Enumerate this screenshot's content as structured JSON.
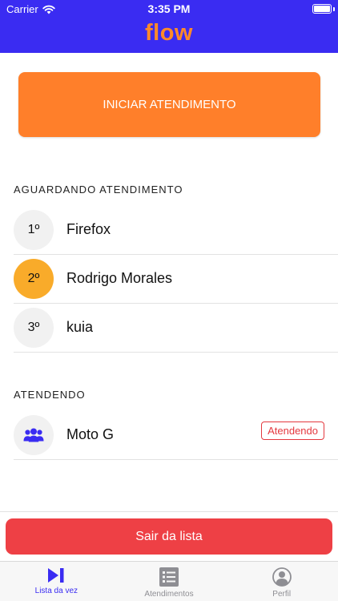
{
  "status_bar": {
    "carrier": "Carrier",
    "time": "3:35 PM"
  },
  "header": {
    "logo": "flow"
  },
  "start_button": {
    "label": "INICIAR ATENDIMENTO"
  },
  "waiting": {
    "title": "AGUARDANDO ATENDIMENTO",
    "items": [
      {
        "position": "1º",
        "name": "Firefox",
        "highlighted": false
      },
      {
        "position": "2º",
        "name": "Rodrigo Morales",
        "highlighted": true
      },
      {
        "position": "3º",
        "name": "kuia",
        "highlighted": false
      }
    ]
  },
  "serving": {
    "title": "ATENDENDO",
    "items": [
      {
        "icon": "users-icon",
        "name": "Moto G",
        "badge": "Atendendo"
      }
    ]
  },
  "exit_button": {
    "label": "Sair da lista"
  },
  "tabs": [
    {
      "label": "Lista da vez",
      "icon": "play-next-icon",
      "active": true
    },
    {
      "label": "Atendimentos",
      "icon": "list-icon",
      "active": false
    },
    {
      "label": "Perfil",
      "icon": "profile-icon",
      "active": false
    }
  ],
  "colors": {
    "header": "#3a2cf2",
    "logo": "#ff8a2a",
    "primary_button": "#ff7f2a",
    "highlight": "#f9ab2a",
    "danger": "#ee4045",
    "tab_active": "#3a2cf2"
  }
}
